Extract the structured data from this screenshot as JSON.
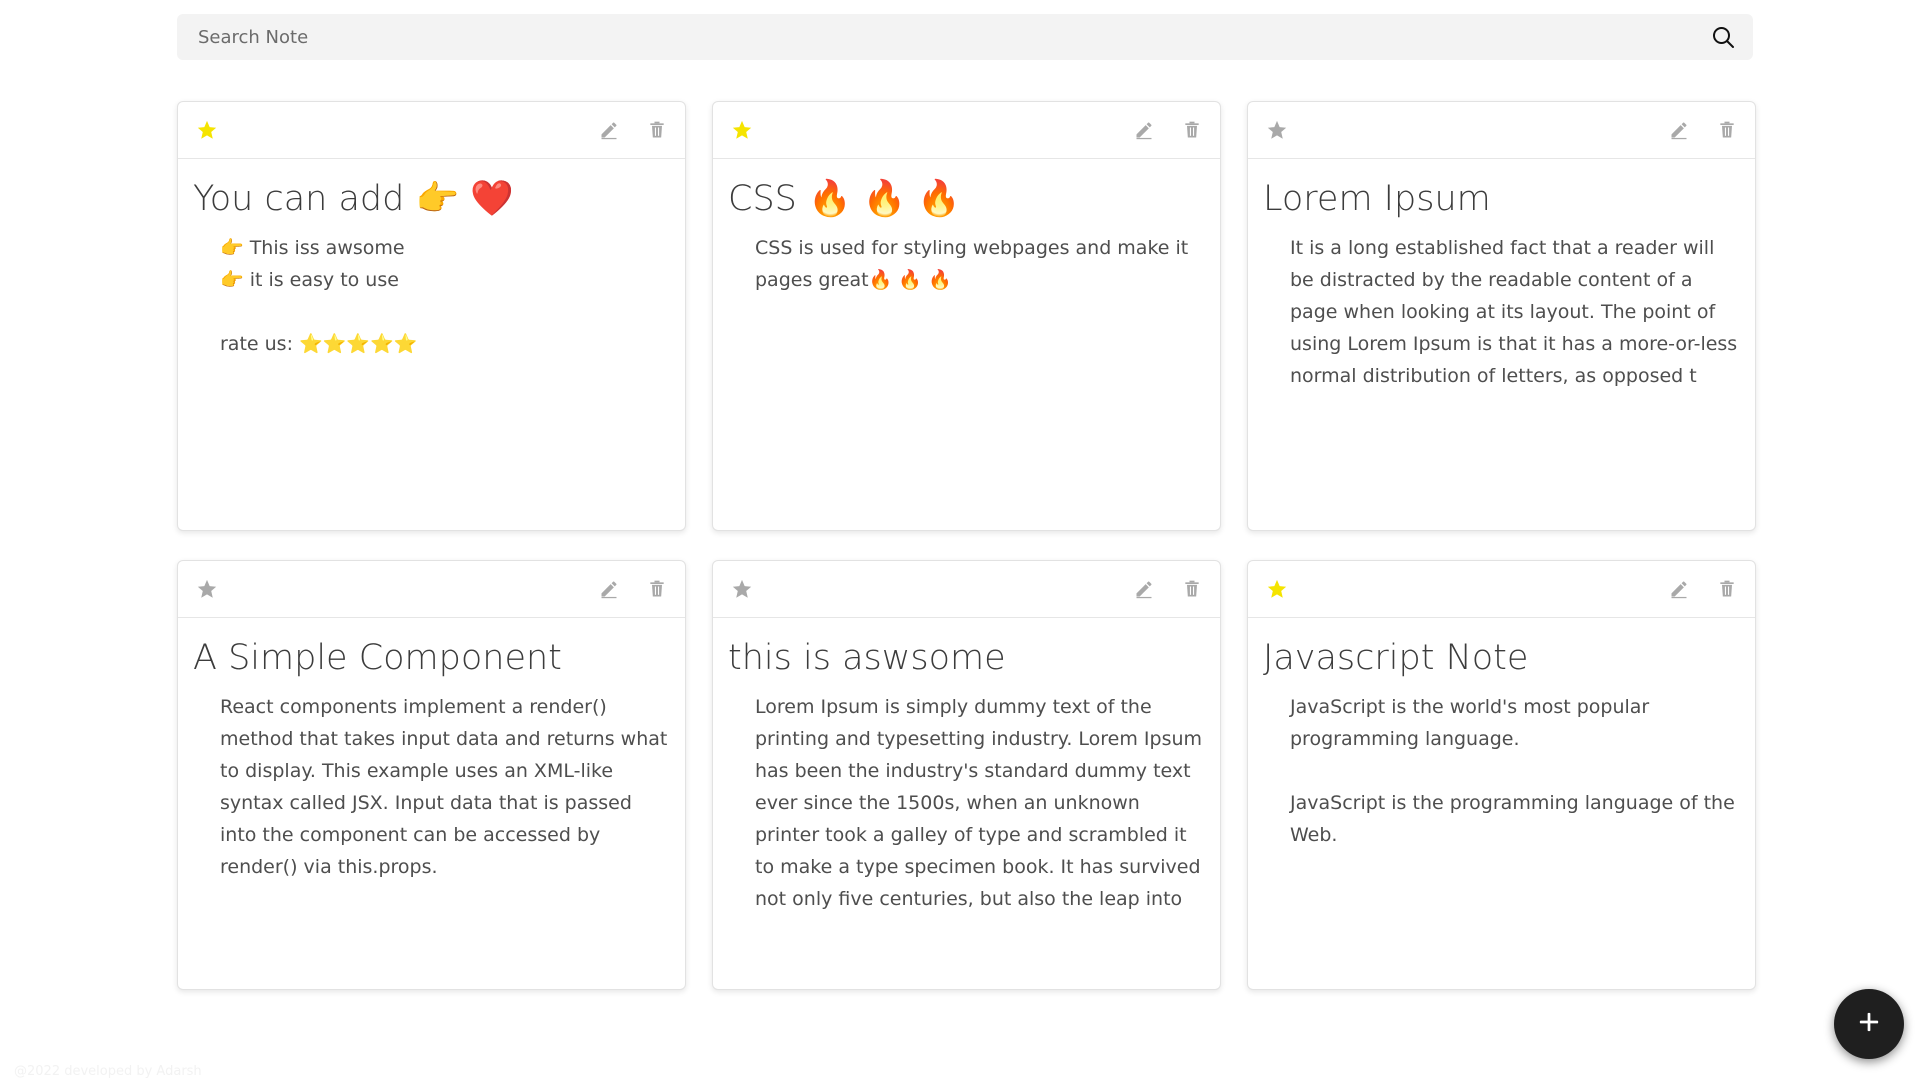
{
  "search": {
    "placeholder": "Search Note",
    "icon": "search-icon"
  },
  "notes": [
    {
      "starred": true,
      "title": "You can add 👉 ❤️",
      "lines": [
        "👉 This iss awsome",
        "👉 it is easy to use",
        "",
        "rate us: ⭐⭐⭐⭐⭐"
      ]
    },
    {
      "starred": true,
      "title": "CSS 🔥 🔥 🔥",
      "lines": [
        "CSS is used for styling webpages and make it pages great🔥 🔥 🔥"
      ]
    },
    {
      "starred": false,
      "title": "Lorem Ipsum",
      "lines": [
        "It is a long established fact that a reader will be distracted by the readable content of a page when looking at its layout. The point of using Lorem Ipsum is that it has a more-or-less normal distribution of letters, as opposed t"
      ]
    },
    {
      "starred": false,
      "title": "A Simple Component",
      "lines": [
        "React components implement a render() method that takes input data and returns what to display. This example uses an XML-like syntax called JSX. Input data that is passed into the component can be accessed by render() via this.props."
      ]
    },
    {
      "starred": false,
      "title": "this is aswsome",
      "lines": [
        "Lorem Ipsum is simply dummy text of the printing and typesetting industry. Lorem Ipsum has been the industry's standard dummy text ever since the 1500s, when an unknown printer took a galley of type and scrambled it to make a type specimen book. It has survived not only five centuries, but also the leap into"
      ]
    },
    {
      "starred": true,
      "title": "Javascript Note",
      "lines": [
        "JavaScript is the world's most popular programming language.",
        "",
        "JavaScript is the programming language of the Web."
      ]
    }
  ],
  "icons": {
    "star": "star-icon",
    "edit": "pencil-icon",
    "delete": "trash-icon",
    "add": "plus-icon"
  },
  "colors": {
    "star_active": "#f5e400",
    "star_inactive": "#a9a9a9",
    "action_icon": "#a9a9a9",
    "fab_bg": "#1f1f1f"
  },
  "fab": {
    "label": "+"
  },
  "footer": {
    "text": "@2022 developed by Adarsh"
  }
}
